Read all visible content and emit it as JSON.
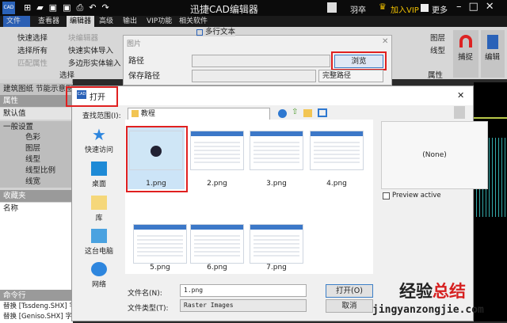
{
  "app": {
    "title": "迅捷CAD编辑器",
    "user": "羽卒",
    "vip": "加入VIP",
    "more": "更多"
  },
  "menu": [
    "文件",
    "查看器",
    "编辑器",
    "高级",
    "输出",
    "VIP功能",
    "相关软件"
  ],
  "ribbon": {
    "select": [
      "快速选择",
      "选择所有",
      "匹配属性"
    ],
    "edit": [
      "块编辑器",
      "快速实体导入",
      "多边形实体输入"
    ],
    "group_select": "选择",
    "multiline": "多行文本",
    "layer": "图层",
    "linetype": "线型",
    "group_props": "属性",
    "snap": "捕捉",
    "edit_btn": "编辑"
  },
  "left_panel": {
    "tabs": "建筑图纸 节能示意图",
    "properties": "属性",
    "default": "默认值",
    "general": "一般设置",
    "items": [
      "色彩",
      "图层",
      "线型",
      "线型比例",
      "线宽"
    ],
    "favorites": "收藏夹",
    "name": "名称",
    "cmdline": "命令行",
    "cmd_lines": [
      "替换 [Tssdeng.SHX] 字体",
      "替换 [Geniso.SHX] 字体"
    ]
  },
  "image_dialog": {
    "title": "图片",
    "path_label": "路径",
    "path_value": "",
    "browse": "浏览",
    "save_path_label": "保存路径",
    "save_path_value": "",
    "path_mode": "完整路径"
  },
  "open_dialog": {
    "title": "打开",
    "look_in_label": "查找范围(I):",
    "look_in": "教程",
    "nav": [
      "快速访问",
      "桌面",
      "库",
      "这台电脑",
      "网络"
    ],
    "files": [
      "1.png",
      "2.png",
      "3.png",
      "4.png",
      "5.png",
      "6.png",
      "7.png"
    ],
    "preview": "(None)",
    "preview_active": "Preview active",
    "filename_label": "文件名(N):",
    "filename": "1.png",
    "filetype_label": "文件类型(T):",
    "filetype": "Raster Images",
    "open": "打开(O)",
    "cancel": "取消"
  },
  "watermark": {
    "line1a": "经验",
    "line1b": "总结",
    "line2": "jingyanzongjie.com"
  }
}
